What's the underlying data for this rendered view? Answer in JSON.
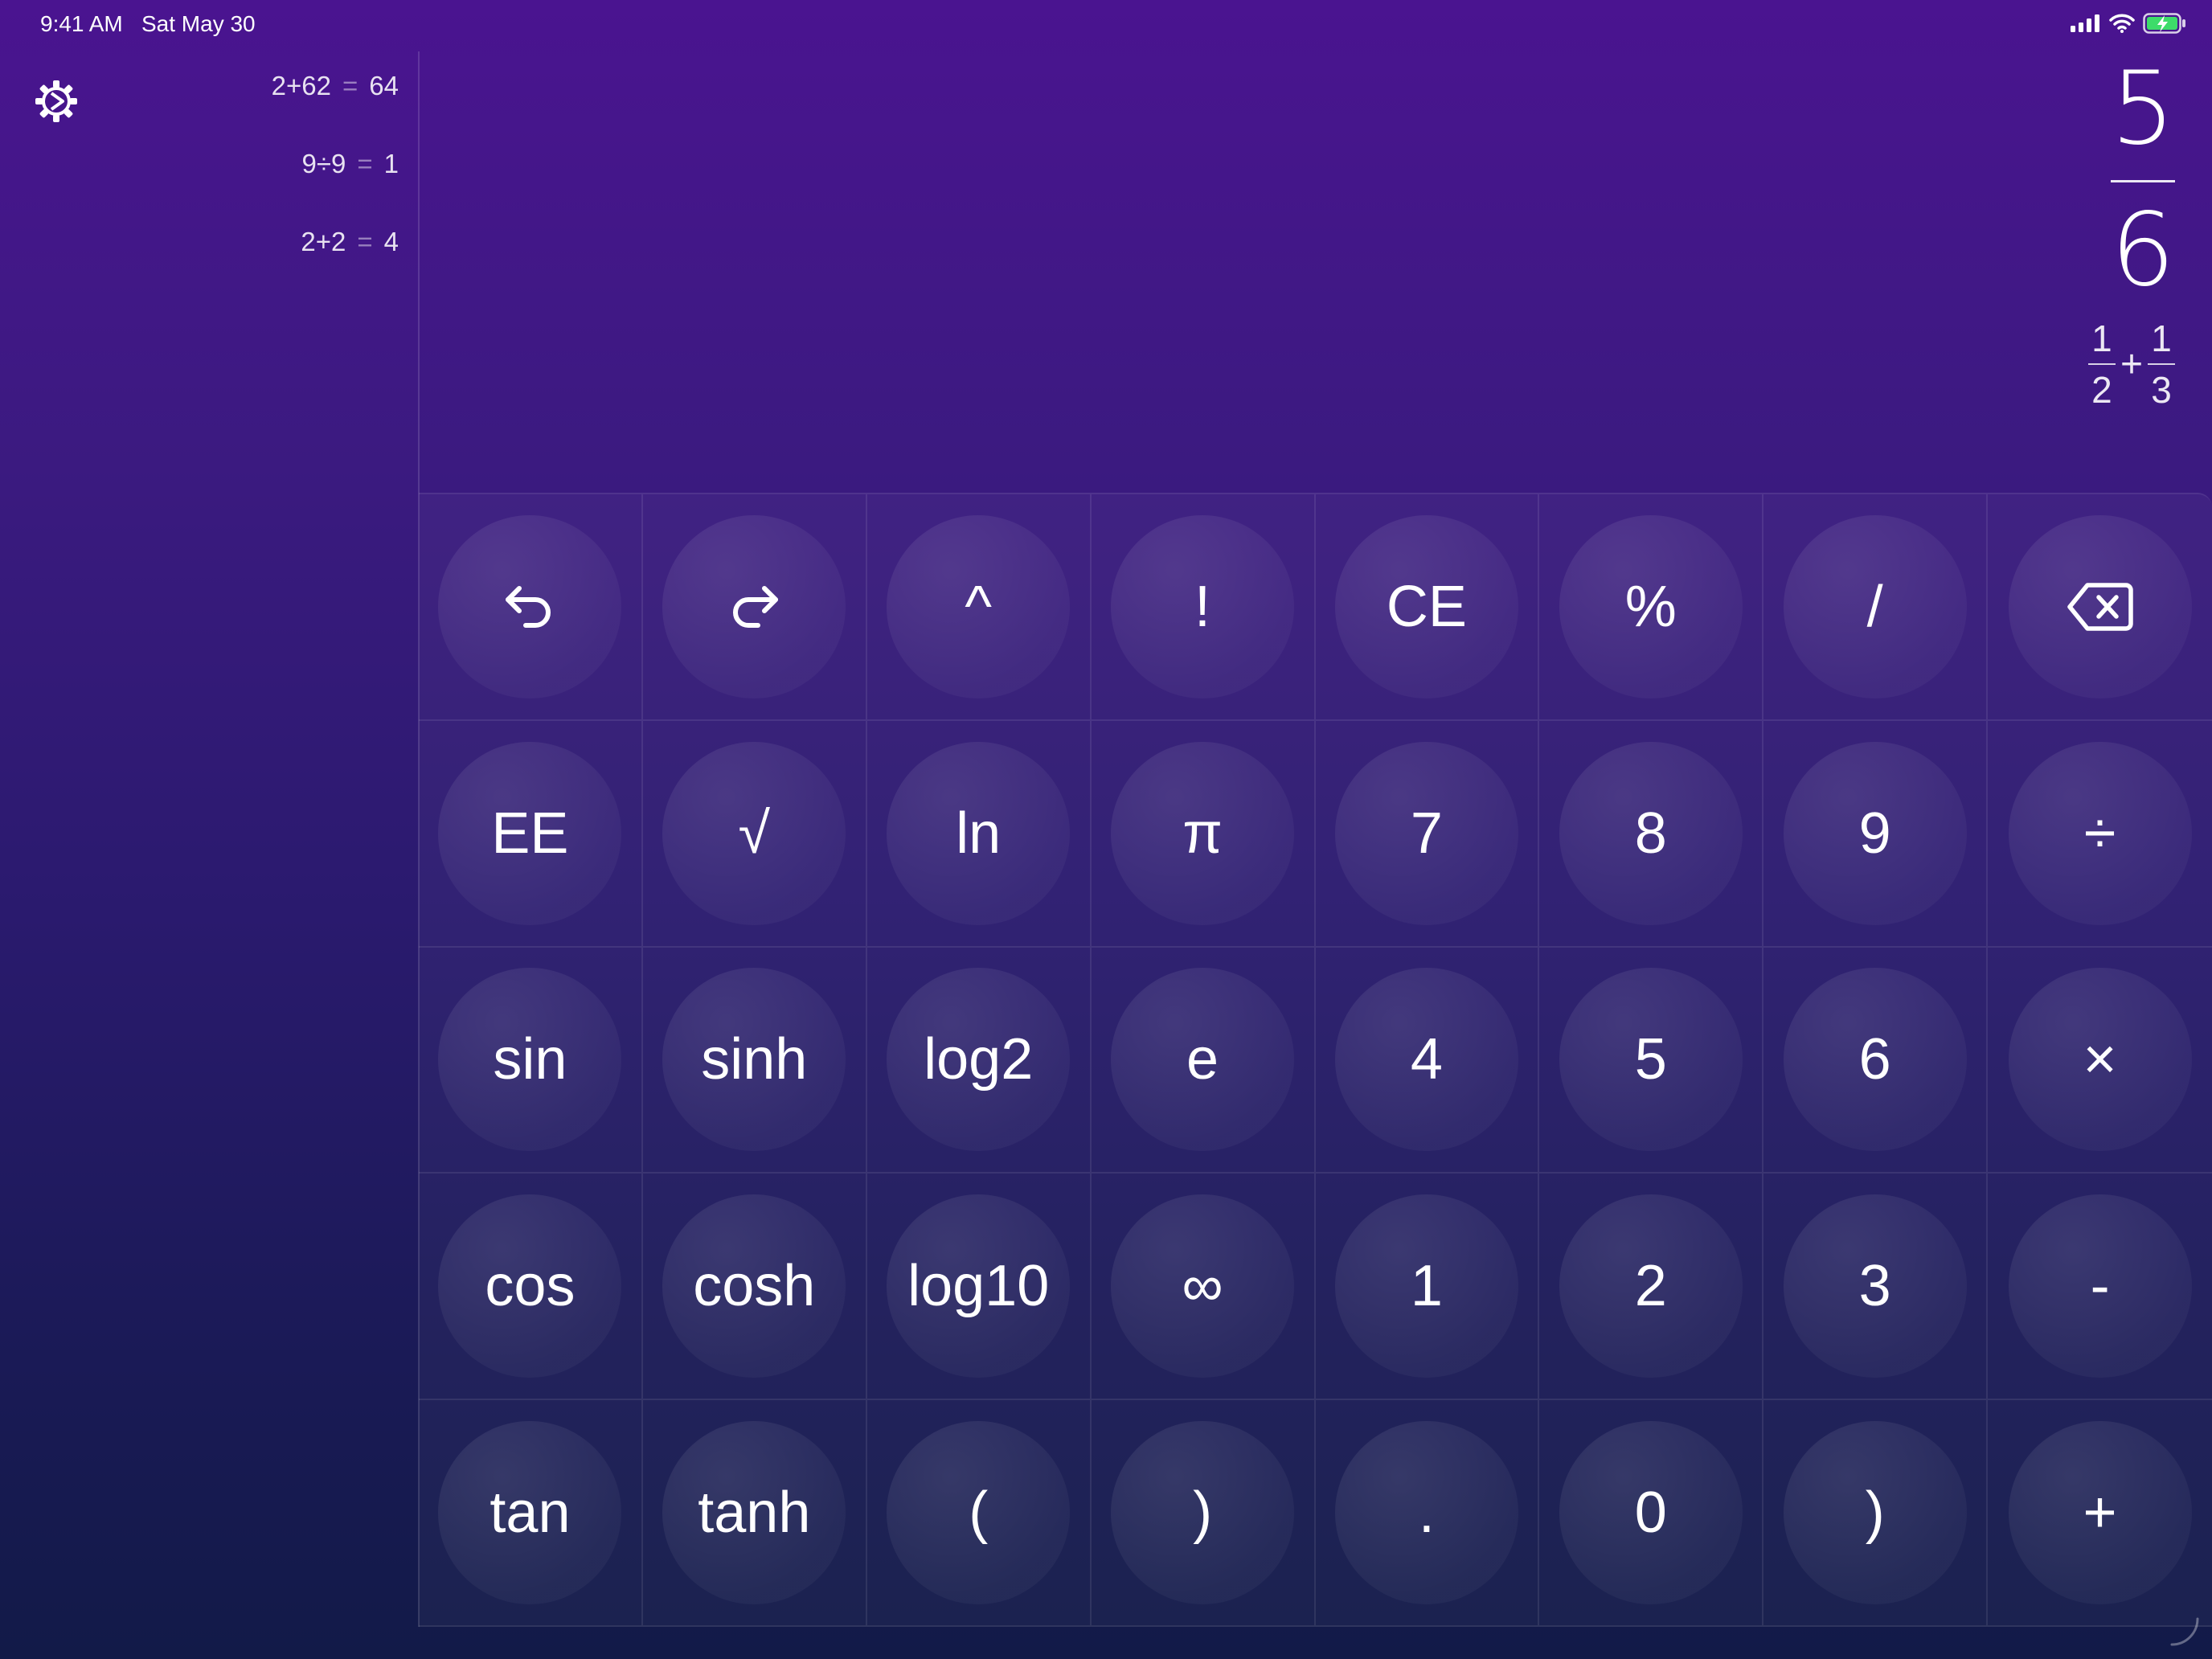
{
  "status_bar": {
    "time": "9:41 AM",
    "date": "Sat May 30",
    "icons": [
      "signal-icon",
      "wifi-icon",
      "battery-charging-icon"
    ]
  },
  "sidebar": {
    "settings_icon": "gear-icon",
    "history": [
      {
        "expr": "2+62",
        "eq": "=",
        "result": "64"
      },
      {
        "expr": "9÷9",
        "eq": "=",
        "result": "1"
      },
      {
        "expr": "2+2",
        "eq": "=",
        "result": "4"
      }
    ]
  },
  "display": {
    "numerator": "5",
    "denominator": "6",
    "expression": {
      "a_num": "1",
      "a_den": "2",
      "op": "+",
      "b_num": "1",
      "b_den": "3"
    }
  },
  "keypad": {
    "rows": [
      [
        "undo-icon",
        "redo-icon",
        "^",
        "!",
        "CE",
        "%",
        "/",
        "backspace-icon"
      ],
      [
        "EE",
        "√",
        "ln",
        "π",
        "7",
        "8",
        "9",
        "÷"
      ],
      [
        "sin",
        "sinh",
        "log2",
        "e",
        "4",
        "5",
        "6",
        "×"
      ],
      [
        "cos",
        "cosh",
        "log10",
        "∞",
        "1",
        "2",
        "3",
        "-"
      ],
      [
        "tan",
        "tanh",
        "(",
        ")",
        ".",
        "0",
        ")",
        "+"
      ]
    ]
  },
  "colors": {
    "background_top": "#4a1490",
    "background_bottom": "#121a48",
    "text": "#ffffff",
    "battery_charge": "#3ddc6a"
  }
}
